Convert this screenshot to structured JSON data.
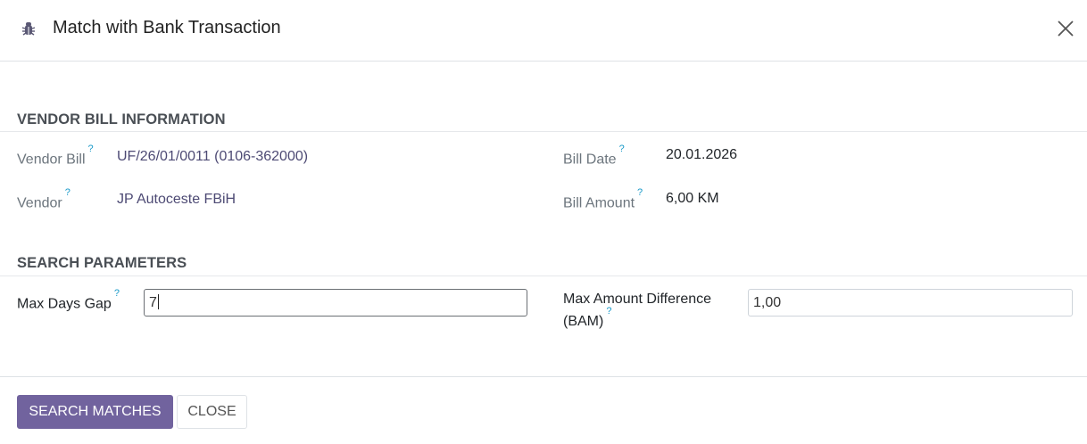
{
  "dialog": {
    "title": "Match with Bank Transaction",
    "close_icon": "close-icon",
    "title_icon": "bug-icon"
  },
  "vendor_section": {
    "title": "VENDOR BILL INFORMATION",
    "vendor_bill_label": "Vendor Bill",
    "vendor_bill_value": "UF/26/01/0011 (0106-362000)",
    "vendor_label": "Vendor",
    "vendor_value": "JP Autoceste FBiH",
    "bill_date_label": "Bill Date",
    "bill_date_value": "20.01.2026",
    "bill_amount_label": "Bill Amount",
    "bill_amount_value": "6,00 KM"
  },
  "search_section": {
    "title": "SEARCH PARAMETERS",
    "max_days_label": "Max Days Gap",
    "max_days_value": "7",
    "max_amount_label_line1": "Max Amount Difference",
    "max_amount_label_line2": "(BAM)",
    "max_amount_value": "1,00"
  },
  "help_mark": "?",
  "footer": {
    "search_button": "SEARCH MATCHES",
    "close_button": "CLOSE"
  },
  "colors": {
    "primary": "#71639e",
    "link": "#4d4a74",
    "help": "#1a9ac9"
  }
}
